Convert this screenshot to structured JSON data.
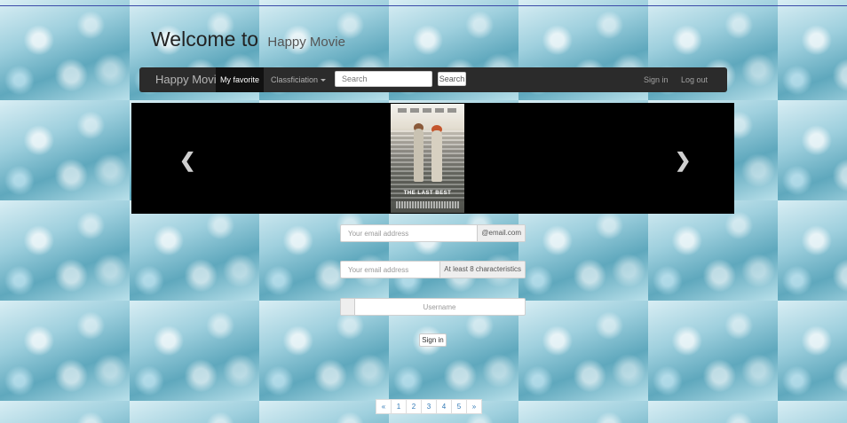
{
  "header": {
    "title": "Welcome to",
    "subtitle": "Happy Movie"
  },
  "navbar": {
    "brand": "Happy Movie",
    "favorite": "My favorite",
    "classification": "Classficiation",
    "search_placeholder": "Search",
    "search_button": "Search",
    "sign_in": "Sign in",
    "log_out": "Log out"
  },
  "carousel": {
    "poster_title": "THE LAST BEST",
    "prev_icon": "chevron-left-icon",
    "next_icon": "chevron-right-icon",
    "prev_glyph": "❮",
    "next_glyph": "❯"
  },
  "form": {
    "email_placeholder": "Your email address",
    "email_addon": "@email.com",
    "password_placeholder": "Your email address",
    "password_addon": "At least 8 characteristics",
    "username_placeholder": "Username",
    "submit": "Sign in"
  },
  "pagination": {
    "prev": "«",
    "pages": [
      "1",
      "2",
      "3",
      "4",
      "5"
    ],
    "next": "»"
  }
}
